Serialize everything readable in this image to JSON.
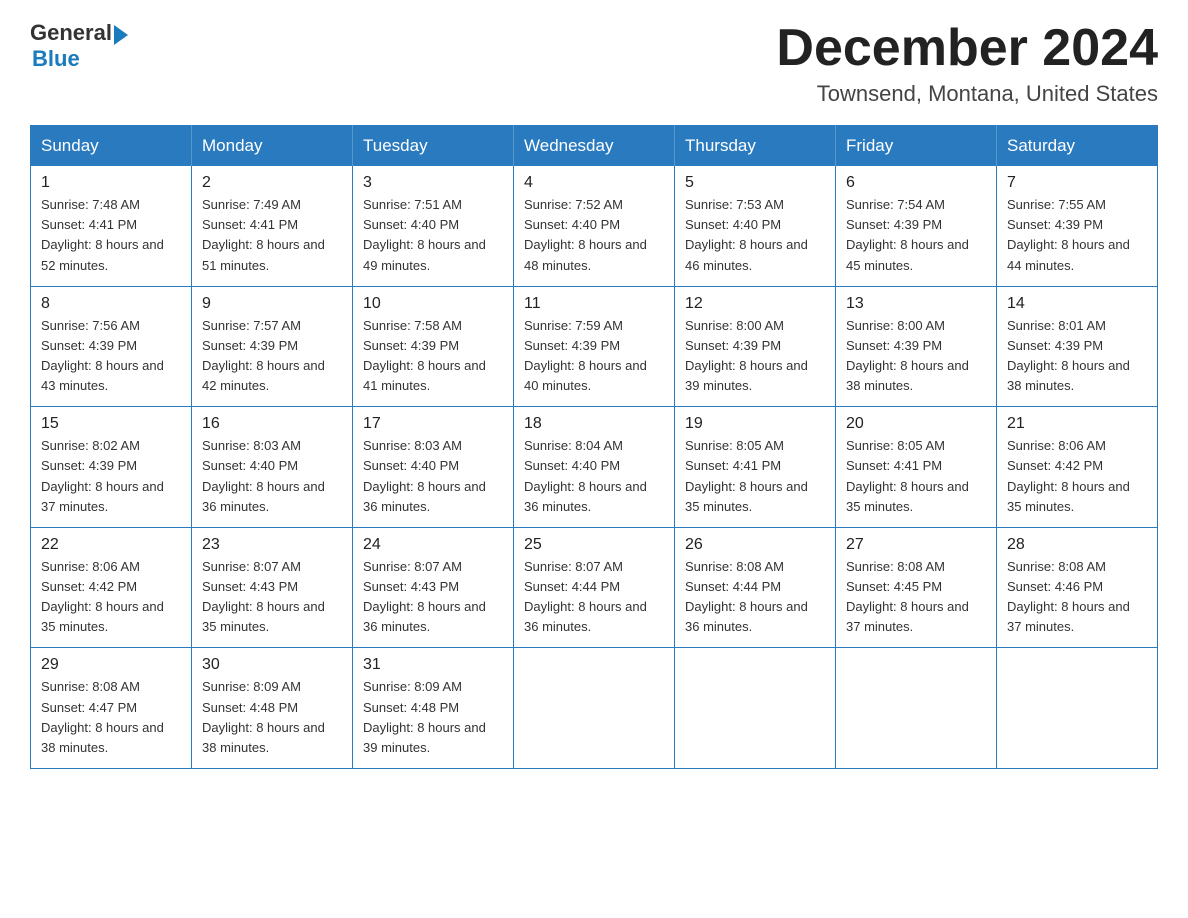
{
  "header": {
    "logo_general": "General",
    "logo_blue": "Blue",
    "month_title": "December 2024",
    "location": "Townsend, Montana, United States"
  },
  "days_of_week": [
    "Sunday",
    "Monday",
    "Tuesday",
    "Wednesday",
    "Thursday",
    "Friday",
    "Saturday"
  ],
  "weeks": [
    [
      {
        "day": "1",
        "sunrise": "7:48 AM",
        "sunset": "4:41 PM",
        "daylight": "8 hours and 52 minutes."
      },
      {
        "day": "2",
        "sunrise": "7:49 AM",
        "sunset": "4:41 PM",
        "daylight": "8 hours and 51 minutes."
      },
      {
        "day": "3",
        "sunrise": "7:51 AM",
        "sunset": "4:40 PM",
        "daylight": "8 hours and 49 minutes."
      },
      {
        "day": "4",
        "sunrise": "7:52 AM",
        "sunset": "4:40 PM",
        "daylight": "8 hours and 48 minutes."
      },
      {
        "day": "5",
        "sunrise": "7:53 AM",
        "sunset": "4:40 PM",
        "daylight": "8 hours and 46 minutes."
      },
      {
        "day": "6",
        "sunrise": "7:54 AM",
        "sunset": "4:39 PM",
        "daylight": "8 hours and 45 minutes."
      },
      {
        "day": "7",
        "sunrise": "7:55 AM",
        "sunset": "4:39 PM",
        "daylight": "8 hours and 44 minutes."
      }
    ],
    [
      {
        "day": "8",
        "sunrise": "7:56 AM",
        "sunset": "4:39 PM",
        "daylight": "8 hours and 43 minutes."
      },
      {
        "day": "9",
        "sunrise": "7:57 AM",
        "sunset": "4:39 PM",
        "daylight": "8 hours and 42 minutes."
      },
      {
        "day": "10",
        "sunrise": "7:58 AM",
        "sunset": "4:39 PM",
        "daylight": "8 hours and 41 minutes."
      },
      {
        "day": "11",
        "sunrise": "7:59 AM",
        "sunset": "4:39 PM",
        "daylight": "8 hours and 40 minutes."
      },
      {
        "day": "12",
        "sunrise": "8:00 AM",
        "sunset": "4:39 PM",
        "daylight": "8 hours and 39 minutes."
      },
      {
        "day": "13",
        "sunrise": "8:00 AM",
        "sunset": "4:39 PM",
        "daylight": "8 hours and 38 minutes."
      },
      {
        "day": "14",
        "sunrise": "8:01 AM",
        "sunset": "4:39 PM",
        "daylight": "8 hours and 38 minutes."
      }
    ],
    [
      {
        "day": "15",
        "sunrise": "8:02 AM",
        "sunset": "4:39 PM",
        "daylight": "8 hours and 37 minutes."
      },
      {
        "day": "16",
        "sunrise": "8:03 AM",
        "sunset": "4:40 PM",
        "daylight": "8 hours and 36 minutes."
      },
      {
        "day": "17",
        "sunrise": "8:03 AM",
        "sunset": "4:40 PM",
        "daylight": "8 hours and 36 minutes."
      },
      {
        "day": "18",
        "sunrise": "8:04 AM",
        "sunset": "4:40 PM",
        "daylight": "8 hours and 36 minutes."
      },
      {
        "day": "19",
        "sunrise": "8:05 AM",
        "sunset": "4:41 PM",
        "daylight": "8 hours and 35 minutes."
      },
      {
        "day": "20",
        "sunrise": "8:05 AM",
        "sunset": "4:41 PM",
        "daylight": "8 hours and 35 minutes."
      },
      {
        "day": "21",
        "sunrise": "8:06 AM",
        "sunset": "4:42 PM",
        "daylight": "8 hours and 35 minutes."
      }
    ],
    [
      {
        "day": "22",
        "sunrise": "8:06 AM",
        "sunset": "4:42 PM",
        "daylight": "8 hours and 35 minutes."
      },
      {
        "day": "23",
        "sunrise": "8:07 AM",
        "sunset": "4:43 PM",
        "daylight": "8 hours and 35 minutes."
      },
      {
        "day": "24",
        "sunrise": "8:07 AM",
        "sunset": "4:43 PM",
        "daylight": "8 hours and 36 minutes."
      },
      {
        "day": "25",
        "sunrise": "8:07 AM",
        "sunset": "4:44 PM",
        "daylight": "8 hours and 36 minutes."
      },
      {
        "day": "26",
        "sunrise": "8:08 AM",
        "sunset": "4:44 PM",
        "daylight": "8 hours and 36 minutes."
      },
      {
        "day": "27",
        "sunrise": "8:08 AM",
        "sunset": "4:45 PM",
        "daylight": "8 hours and 37 minutes."
      },
      {
        "day": "28",
        "sunrise": "8:08 AM",
        "sunset": "4:46 PM",
        "daylight": "8 hours and 37 minutes."
      }
    ],
    [
      {
        "day": "29",
        "sunrise": "8:08 AM",
        "sunset": "4:47 PM",
        "daylight": "8 hours and 38 minutes."
      },
      {
        "day": "30",
        "sunrise": "8:09 AM",
        "sunset": "4:48 PM",
        "daylight": "8 hours and 38 minutes."
      },
      {
        "day": "31",
        "sunrise": "8:09 AM",
        "sunset": "4:48 PM",
        "daylight": "8 hours and 39 minutes."
      },
      null,
      null,
      null,
      null
    ]
  ]
}
